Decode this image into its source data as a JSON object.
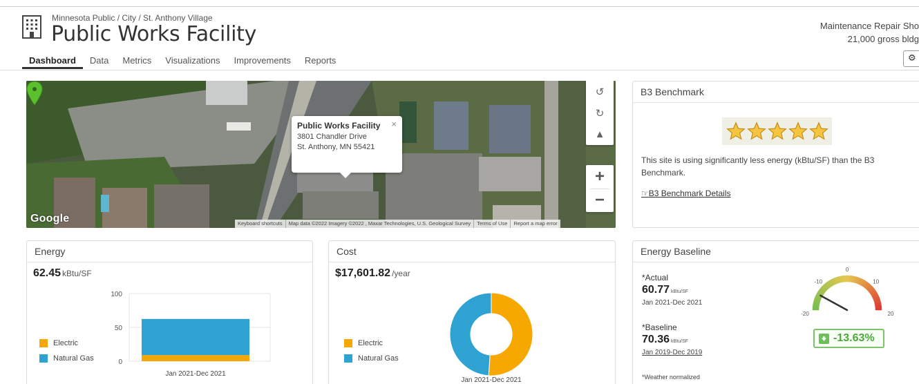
{
  "header": {
    "breadcrumb": "Minnesota Public / City / St. Anthony Village",
    "title": "Public Works Facility",
    "building_type": "Maintenance Repair Sho",
    "area": "21,000 gross bldg",
    "icons": {
      "building": "building-icon",
      "settings": "gears-icon"
    }
  },
  "tabs": [
    {
      "label": "Dashboard",
      "active": true
    },
    {
      "label": "Data"
    },
    {
      "label": "Metrics"
    },
    {
      "label": "Visualizations"
    },
    {
      "label": "Improvements"
    },
    {
      "label": "Reports"
    }
  ],
  "map": {
    "popup": {
      "name": "Public Works Facility",
      "address_line1": "3801 Chandler Drive",
      "address_line2": "St. Anthony, MN 55421",
      "close": "×"
    },
    "controls": {
      "zoom_in": "+",
      "zoom_out": "−"
    },
    "logo": "Google",
    "attribution": [
      "Keyboard shortcuts",
      "Map data ©2022 Imagery ©2022 , Maxar Technologies, U.S. Geological Survey",
      "Terms of Use",
      "Report a map error"
    ]
  },
  "b3": {
    "title": "B3 Benchmark",
    "stars": 5,
    "stars_max": 5,
    "text": "This site is using significantly less energy (kBtu/SF) than the B3 Benchmark.",
    "link": "B3 Benchmark Details",
    "star_color": "#f5c542"
  },
  "energy": {
    "title": "Energy",
    "value": "62.45",
    "unit": "kBtu/SF",
    "legend": [
      {
        "label": "Electric",
        "color": "#f7a800"
      },
      {
        "label": "Natural Gas",
        "color": "#2ea3d2"
      }
    ]
  },
  "cost": {
    "title": "Cost",
    "value": "$17,601.82",
    "unit": "/year",
    "legend": [
      {
        "label": "Electric",
        "color": "#f7a800"
      },
      {
        "label": "Natural Gas",
        "color": "#2ea3d2"
      }
    ]
  },
  "baseline": {
    "title": "Energy Baseline",
    "actual_label": "*Actual",
    "actual_value": "60.77",
    "actual_unit": "kBtu/SF",
    "actual_range": "Jan 2021-Dec 2021",
    "baseline_label": "*Baseline",
    "baseline_value": "70.36",
    "baseline_unit": "kBtu/SF",
    "baseline_range": "Jan 2019-Dec 2019",
    "note": "*Weather normalized",
    "delta": "-13.63%",
    "gauge": {
      "min": -20,
      "max": 20,
      "ticks": [
        "-20",
        "-10",
        "0",
        "10",
        "20"
      ],
      "value": -13.63
    }
  },
  "chart_data": [
    {
      "type": "bar",
      "stacked": true,
      "categories": [
        "Jan 2021-Dec 2021"
      ],
      "series": [
        {
          "name": "Electric",
          "values": [
            9
          ],
          "color": "#f7a800"
        },
        {
          "name": "Natural Gas",
          "values": [
            53.45
          ],
          "color": "#2ea3d2"
        }
      ],
      "ylim": [
        0,
        100
      ],
      "yticks": [
        "0",
        "50",
        "100"
      ],
      "grid": true,
      "legend": "left"
    },
    {
      "type": "pie",
      "donut": true,
      "categories": [
        "Jan 2021-Dec 2021"
      ],
      "series": [
        {
          "name": "Electric",
          "values": [
            51
          ],
          "color": "#f7a800"
        },
        {
          "name": "Natural Gas",
          "values": [
            49
          ],
          "color": "#2ea3d2"
        }
      ],
      "legend": "left"
    }
  ]
}
